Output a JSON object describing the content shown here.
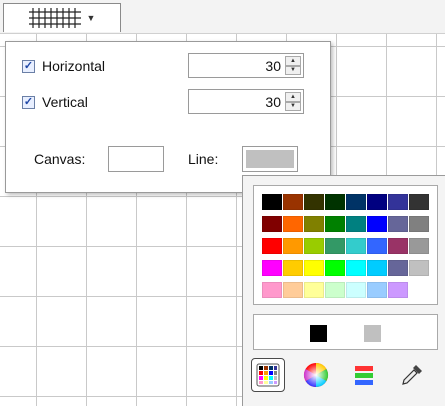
{
  "toolbar": {
    "grid_button_icon": "grid-icon",
    "dropdown_icon": "chevron-down-icon"
  },
  "grid_settings": {
    "horizontal": {
      "label": "Horizontal",
      "checked": true,
      "value": "30"
    },
    "vertical": {
      "label": "Vertical",
      "checked": true,
      "value": "30"
    },
    "canvas_label": "Canvas:",
    "canvas_color": "#ffffff",
    "line_label": "Line:",
    "line_color": "#c0c0c0"
  },
  "color_picker": {
    "palette": [
      [
        "#000000",
        "#993300",
        "#333300",
        "#003300",
        "#003366",
        "#000080",
        "#333399",
        "#333333"
      ],
      [
        "#800000",
        "#ff6600",
        "#808000",
        "#008000",
        "#008080",
        "#0000ff",
        "#666699",
        "#808080"
      ],
      [
        "#ff0000",
        "#ff9900",
        "#99cc00",
        "#339966",
        "#33cccc",
        "#3366ff",
        "#993366",
        "#999999"
      ],
      [
        "#ff00ff",
        "#ffcc00",
        "#ffff00",
        "#00ff00",
        "#00ffff",
        "#00ccff",
        "#666699",
        "#c0c0c0"
      ],
      [
        "#ff99cc",
        "#ffcc99",
        "#ffff99",
        "#ccffcc",
        "#ccffff",
        "#99ccff",
        "#cc99ff",
        ""
      ]
    ],
    "recent_colors": [
      "#000000",
      "#c0c0c0"
    ],
    "tools": [
      "palette-icon",
      "color-wheel-icon",
      "gradient-icon",
      "eyedropper-icon"
    ]
  }
}
